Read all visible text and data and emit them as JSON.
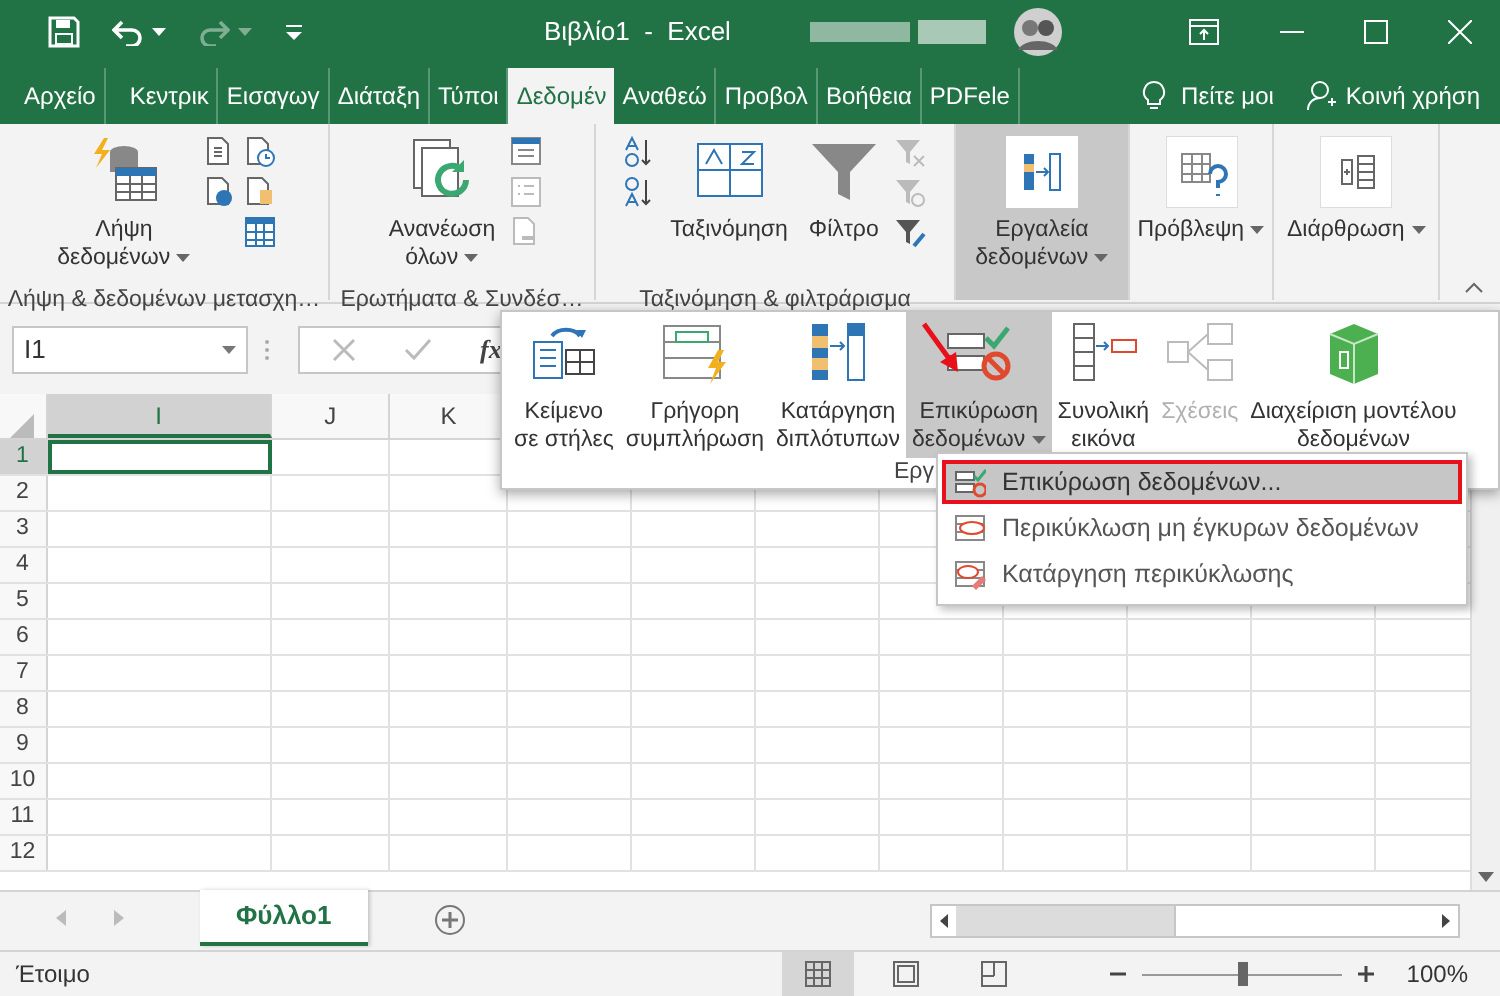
{
  "title_bar": {
    "title": "Βιβλίο1  -  Excel"
  },
  "ribbon_tabs": [
    {
      "label": "Αρχείο",
      "selected": false
    },
    {
      "label": "Κεντρικ",
      "selected": false
    },
    {
      "label": "Εισαγωγ",
      "selected": false
    },
    {
      "label": "Διάταξη",
      "selected": false
    },
    {
      "label": "Τύποι",
      "selected": false
    },
    {
      "label": "Δεδομέν",
      "selected": true
    },
    {
      "label": "Αναθεώ",
      "selected": false
    },
    {
      "label": "Προβολ",
      "selected": false
    },
    {
      "label": "Βοήθεια",
      "selected": false
    },
    {
      "label": "PDFele",
      "selected": false
    }
  ],
  "tell_me": "Πείτε μοι",
  "share": "Κοινή χρήση",
  "ribbon_groups": [
    {
      "label": "Λήψη & δεδομένων μετασχη…",
      "buttons": [
        {
          "lines": [
            "Λήψη",
            "δεδομένων"
          ],
          "dropdown": true,
          "selected": false
        }
      ]
    },
    {
      "label": "Ερωτήματα & Συνδέσ…",
      "buttons": [
        {
          "lines": [
            "Ανανέωση",
            "όλων"
          ],
          "dropdown": true,
          "selected": false
        }
      ]
    },
    {
      "label": "Ταξινόμηση & φιλτράρισμα",
      "buttons": [
        {
          "lines": [
            "Ταξινόμηση"
          ],
          "dropdown": false,
          "selected": false
        },
        {
          "lines": [
            "Φίλτρο"
          ],
          "dropdown": false,
          "selected": false
        }
      ]
    },
    {
      "buttons": [
        {
          "lines": [
            "Εργαλεία",
            "δεδομένων"
          ],
          "dropdown": true,
          "selected": true
        }
      ]
    },
    {
      "buttons": [
        {
          "lines": [
            "Πρόβλεψη"
          ],
          "dropdown": true,
          "selected": false
        }
      ]
    },
    {
      "buttons": [
        {
          "lines": [
            "Διάρθρωση"
          ],
          "dropdown": true,
          "selected": false
        }
      ]
    }
  ],
  "name_box": "I1",
  "formula_bar": {
    "function_label": "fx"
  },
  "sheet": {
    "columns": [
      {
        "label": "I",
        "selected": true
      },
      {
        "label": "J",
        "selected": false
      },
      {
        "label": "K",
        "selected": false
      }
    ],
    "rows": [
      {
        "label": "1",
        "selected": true
      },
      {
        "label": "2",
        "selected": false
      },
      {
        "label": "3",
        "selected": false
      },
      {
        "label": "4",
        "selected": false
      },
      {
        "label": "5",
        "selected": false
      },
      {
        "label": "6",
        "selected": false
      },
      {
        "label": "7",
        "selected": false
      },
      {
        "label": "8",
        "selected": false
      },
      {
        "label": "9",
        "selected": false
      },
      {
        "label": "10",
        "selected": false
      },
      {
        "label": "11",
        "selected": false
      },
      {
        "label": "12",
        "selected": false
      }
    ]
  },
  "data_tools_panel": {
    "group_label": "Εργ",
    "buttons": [
      {
        "lines": [
          "Κείμενο",
          "σε στήλες"
        ],
        "dropdown": false,
        "disabled": false,
        "selected": false
      },
      {
        "lines": [
          "Γρήγορη",
          "συμπλήρωση"
        ],
        "dropdown": false,
        "disabled": false,
        "selected": false
      },
      {
        "lines": [
          "Κατάργηση",
          "διπλότυπων"
        ],
        "dropdown": false,
        "disabled": false,
        "selected": false
      },
      {
        "lines": [
          "Επικύρωση",
          "δεδομένων"
        ],
        "dropdown": true,
        "disabled": false,
        "selected": true
      },
      {
        "lines": [
          "Συνολική",
          "εικόνα"
        ],
        "dropdown": false,
        "disabled": false,
        "selected": false
      },
      {
        "lines": [
          "Σχέσεις"
        ],
        "dropdown": false,
        "disabled": true,
        "selected": false
      },
      {
        "lines": [
          "Διαχείριση μοντέλου",
          "δεδομένων"
        ],
        "dropdown": false,
        "disabled": false,
        "selected": false
      }
    ]
  },
  "validation_menu": [
    {
      "label": "Επικύρωση δεδομένων...",
      "selected": true,
      "outlined": true
    },
    {
      "label": "Περικύκλωση μη έγκυρων δεδομένων",
      "selected": false,
      "outlined": false
    },
    {
      "label": "Κατάργηση περικύκλωσης",
      "selected": false,
      "outlined": false
    }
  ],
  "sheet_tabs": [
    {
      "label": "Φύλλο1",
      "selected": true
    }
  ],
  "status_bar": {
    "text": "Έτοιμο",
    "views": [
      {
        "kind": "normal",
        "selected": true
      },
      {
        "kind": "page_layout",
        "selected": false
      },
      {
        "kind": "page_break",
        "selected": false
      }
    ],
    "zoom": {
      "level": 0.5,
      "reading": "100%"
    }
  }
}
